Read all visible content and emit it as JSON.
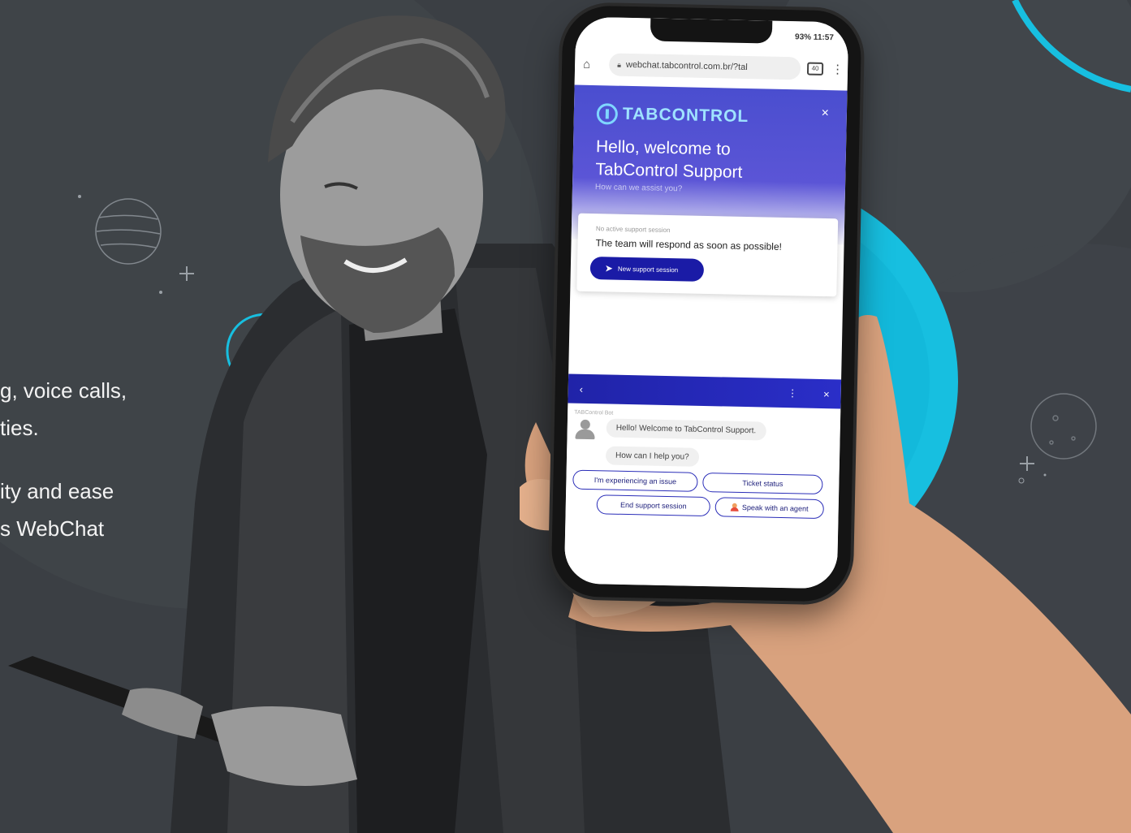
{
  "side_copy": {
    "line1": "g, voice calls,",
    "line2": "ties.",
    "line3": "ity and ease",
    "line4": "s WebChat"
  },
  "phone": {
    "status": "93% 11:57",
    "url": "webchat.tabcontrol.com.br/?tal",
    "tab_count": "40",
    "home_icon": "home-icon",
    "menu_icon": "kebab-icon"
  },
  "hero": {
    "brand": "TABCONTROL",
    "close": "×",
    "title_line1": "Hello, welcome to",
    "title_line2": "TabControl Support",
    "subtitle": "How can we assist you?"
  },
  "session_card": {
    "label": "No active support session",
    "message": "The team will respond as soon as possible!",
    "button": "New support session"
  },
  "chat_header": {
    "back": "‹",
    "menu": "⋮",
    "close": "×"
  },
  "chat": {
    "bot_name": "TABControl Bot",
    "messages": [
      "Hello! Welcome to TabControl Support.",
      "How can I help you?"
    ],
    "quick_replies": [
      "I'm experiencing an issue",
      "Ticket status",
      "End support session",
      "Speak with an agent"
    ]
  },
  "colors": {
    "background": "#3b3f44",
    "accent_cyan": "#17bfe0",
    "brand_blue": "#2a2db8",
    "hero_purple": "#4a4ecf"
  }
}
